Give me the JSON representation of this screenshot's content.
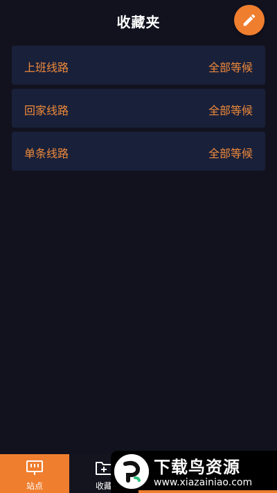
{
  "header": {
    "title": "收藏夹",
    "edit_icon": "pencil-icon"
  },
  "routes": [
    {
      "name": "上班线路",
      "status": "全部等候"
    },
    {
      "name": "回家线路",
      "status": "全部等候"
    },
    {
      "name": "单条线路",
      "status": "全部等候"
    }
  ],
  "bottom_nav": {
    "tabs": [
      {
        "label": "站点",
        "icon": "bus-stop-icon",
        "active": true
      },
      {
        "label": "收藏",
        "icon": "folder-add-icon",
        "active": false
      }
    ]
  },
  "watermark": {
    "title": "下载鸟资源",
    "url": "www.xiazainiao.com"
  },
  "colors": {
    "background": "#12121f",
    "accent": "#ef7e2f",
    "card": "#19203a"
  }
}
